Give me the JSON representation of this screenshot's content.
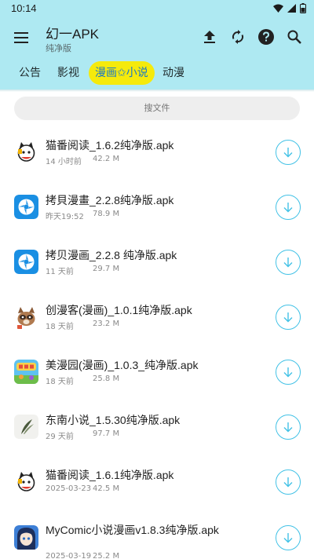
{
  "status_bar": {
    "time": "10:14"
  },
  "appbar": {
    "title": "幻一APK",
    "subtitle": "纯净版",
    "actions": [
      "upload-icon",
      "refresh-icon",
      "help-icon",
      "search-icon"
    ]
  },
  "tabs": [
    {
      "label": "公告",
      "active": false
    },
    {
      "label": "影视",
      "active": false
    },
    {
      "label": "漫画✩小说",
      "active": true
    },
    {
      "label": "动漫",
      "active": false
    }
  ],
  "search": {
    "placeholder": "搜文件"
  },
  "files": [
    {
      "name": "猫番阅读_1.6.2纯净版.apk",
      "time": "14 小时前",
      "size": "42.2 M",
      "icon": "cat-reader-icon"
    },
    {
      "name": "拷貝漫畫_2.2.8纯净版.apk",
      "time": "昨天19:52",
      "size": "78.9 M",
      "icon": "copy-manga-icon"
    },
    {
      "name": "拷贝漫画_2.2.8 纯净版.apk",
      "time": "11 天前",
      "size": "29.7 M",
      "icon": "copy-manga-icon"
    },
    {
      "name": "创漫客(漫画)_1.0.1纯净版.apk",
      "time": "18 天前",
      "size": "23.2 M",
      "icon": "raccoon-icon"
    },
    {
      "name": "美漫园(漫画)_1.0.3_纯净版.apk",
      "time": "18 天前",
      "size": "25.8 M",
      "icon": "meimanyuan-icon"
    },
    {
      "name": "东南小说_1.5.30纯净版.apk",
      "time": "29 天前",
      "size": "97.7 M",
      "icon": "feather-icon"
    },
    {
      "name": "猫番阅读_1.6.1纯净版.apk",
      "time": "2025-03-23",
      "size": "42.5 M",
      "icon": "cat-reader-icon"
    },
    {
      "name": "MyComic小说漫画v1.8.3纯净版.apk",
      "time": "2025-03-19",
      "size": "25.2 M",
      "icon": "anime-girl-icon"
    }
  ],
  "colors": {
    "header": "#aee9f2",
    "active_tab_bg": "#f5ea0c",
    "active_tab_text": "#1c79c7",
    "download_ring": "#43c2e6"
  }
}
